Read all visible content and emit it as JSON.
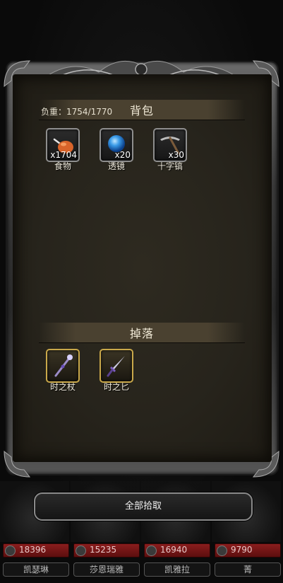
{
  "bag": {
    "title": "背包",
    "load_label": "负重：1754/1770",
    "items": [
      {
        "name": "食物",
        "count": "x1704",
        "icon": "food-icon"
      },
      {
        "name": "透镜",
        "count": "x20",
        "icon": "lens-icon"
      },
      {
        "name": "十字镐",
        "count": "x30",
        "icon": "pickaxe-icon"
      }
    ]
  },
  "drop": {
    "title": "掉落",
    "items": [
      {
        "name": "时之杖",
        "icon": "staff-icon"
      },
      {
        "name": "时之匕",
        "icon": "dagger-icon"
      }
    ]
  },
  "pickup_all_label": "全部拾取",
  "heroes": [
    {
      "hp": "18396",
      "name": "凯瑟琳"
    },
    {
      "hp": "15235",
      "name": "莎恩瑞雅"
    },
    {
      "hp": "16940",
      "name": "凯雅拉"
    },
    {
      "hp": "9790",
      "name": "菁"
    }
  ],
  "colors": {
    "panel_bg": "#27241c",
    "header_bg": "#4a4130",
    "rare_border": "#c9a84a",
    "hp_bar": "#8a1d1d"
  }
}
